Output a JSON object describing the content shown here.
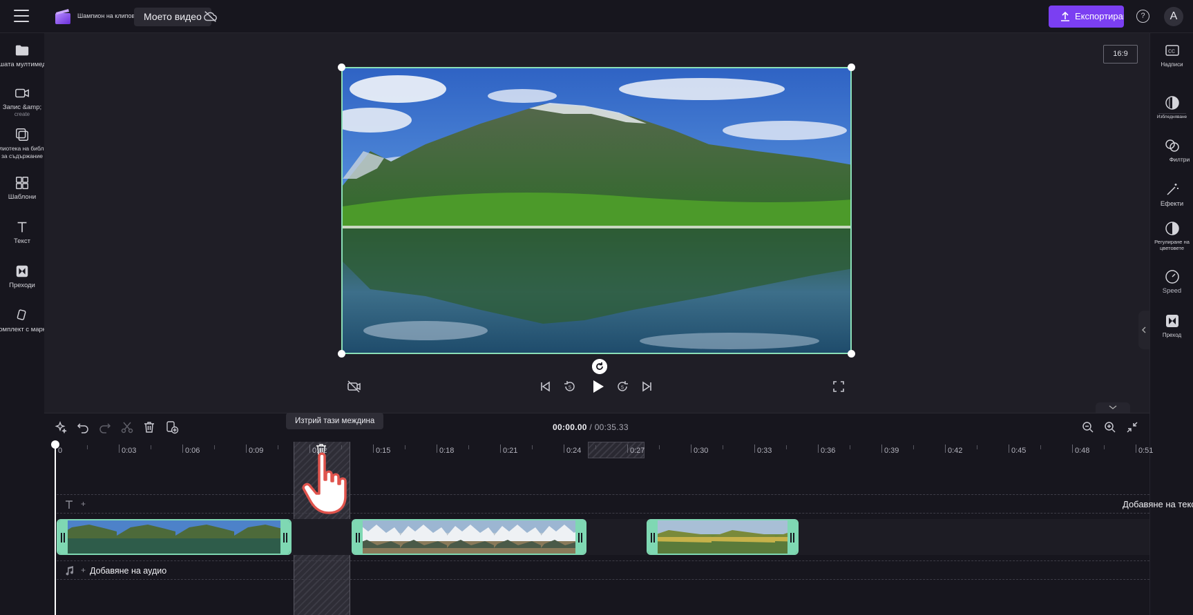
{
  "header": {
    "app_name": "Шампион на клиповете",
    "project_name": "Моето видео",
    "export_label": "Експортиране",
    "help_label": "?",
    "avatar_initial": "A"
  },
  "left_sidebar": {
    "items": [
      {
        "label": "Вашата мултимедия",
        "icon": "folder-icon"
      },
      {
        "label": "Запис &amp;",
        "sublabel": "create",
        "icon": "camera-icon"
      },
      {
        "label": "Библиотека на библиотека",
        "sublabel": "за съдържание",
        "icon": "content-library-icon"
      },
      {
        "label": "Шаблони",
        "icon": "templates-icon"
      },
      {
        "label": "Текст",
        "icon": "text-icon"
      },
      {
        "label": "Преходи",
        "icon": "transitions-icon"
      },
      {
        "label": "Комплект с марки",
        "icon": "brand-kit-icon"
      }
    ]
  },
  "right_sidebar": {
    "items": [
      {
        "label": "Надписи",
        "icon": "captions-icon"
      },
      {
        "label": "Избледняване",
        "icon": "fade-icon"
      },
      {
        "label": "Филтри",
        "icon": "filters-icon"
      },
      {
        "label": "Ефекти",
        "icon": "effects-icon"
      },
      {
        "label": "Регулиране на цветовете",
        "icon": "color-adjust-icon"
      },
      {
        "label": "Speed",
        "icon": "speed-icon"
      },
      {
        "label": "Преход",
        "icon": "transition-icon"
      }
    ]
  },
  "stage": {
    "aspect_ratio": "16:9"
  },
  "timeline": {
    "tooltip": "Изтрий тази междина",
    "current_time": "00:00.00",
    "total_time": "/ 00:35.33",
    "ruler_labels": [
      "0",
      "0:03",
      "0:06",
      "0:09",
      "0:12",
      "0:15",
      "0:18",
      "0:21",
      "0:24",
      "0:27",
      "0:30",
      "0:33",
      "0:36",
      "0:39",
      "0:42",
      "0:45",
      "0:48",
      "0:51"
    ],
    "add_text_label": "Добавяне на текст",
    "add_audio_label": "Добавяне на аудио"
  },
  "colors": {
    "accent": "#7b3ff2",
    "clip_border": "#7fd8b3",
    "background": "#17161e"
  }
}
